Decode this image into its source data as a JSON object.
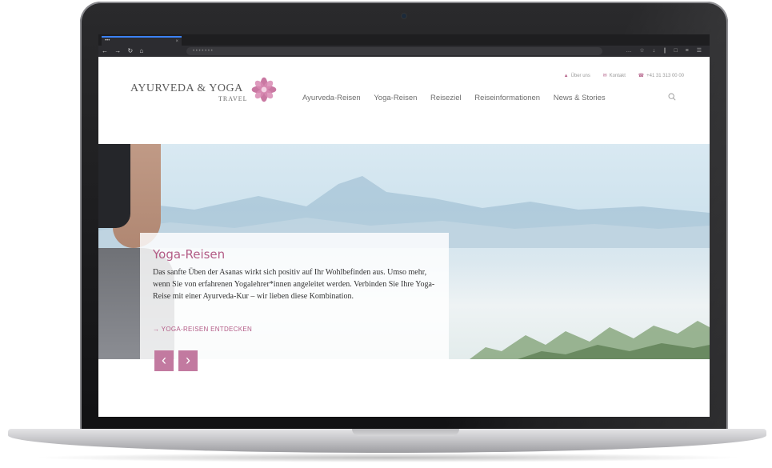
{
  "browser": {
    "tab_title": "•••",
    "tab_close": "×",
    "nav_buttons": "← → ↻ ⌂",
    "url": "• • • • • • •",
    "toolbar_icons": "… ☆ ↓  ∥ □ ≡ ☰"
  },
  "site": {
    "logo_main": "AYURVEDA & YOGA",
    "logo_sub": "TRAVEL",
    "top_links": [
      {
        "label": "Über uns",
        "icon": "person-icon",
        "icon_glyph": "▲"
      },
      {
        "label": "Kontakt",
        "icon": "mail-icon",
        "icon_glyph": "✉"
      },
      {
        "label": "+41 31 313 00 00",
        "icon": "phone-icon",
        "icon_glyph": "☎"
      }
    ],
    "nav": [
      "Ayurveda-Reisen",
      "Yoga-Reisen",
      "Reiseziel",
      "Reiseinformationen",
      "News & Stories"
    ]
  },
  "hero": {
    "title": "Yoga-Reisen",
    "text": "Das sanfte Üben der Asanas wirkt sich positiv auf Ihr Wohlbefinden aus. Umso mehr, wenn Sie von erfahrenen Yogalehrer*innen angeleitet werden. Verbinden Sie Ihre Yoga-Reise mit einer Ayurveda-Kur – wir lieben diese Kombination.",
    "link": "→ YOGA-REISEN ENTDECKEN",
    "prev": "‹",
    "next": "›"
  },
  "colors": {
    "accent": "#b35c86",
    "button": "#c27aa0"
  }
}
